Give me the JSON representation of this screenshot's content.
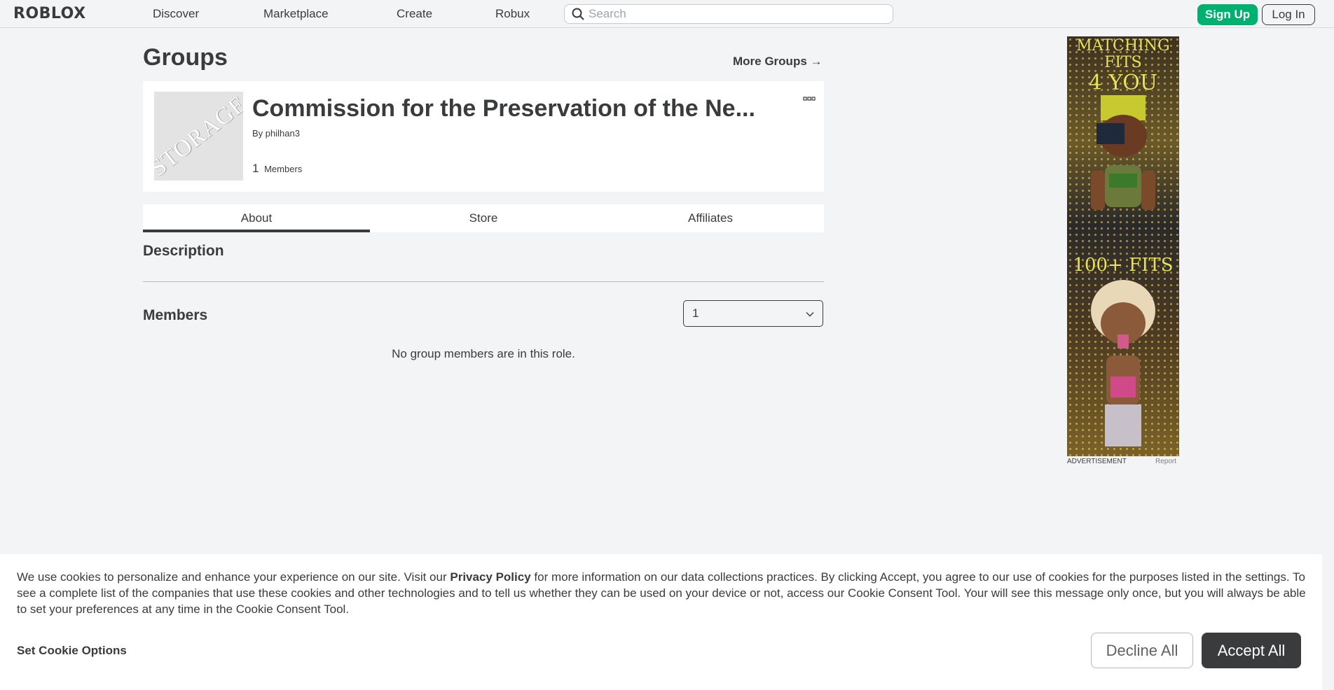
{
  "header": {
    "logo": "ROBLOX",
    "nav": [
      "Discover",
      "Marketplace",
      "Create",
      "Robux"
    ],
    "search_placeholder": "Search",
    "signup_label": "Sign Up",
    "login_label": "Log In"
  },
  "page": {
    "title": "Groups",
    "more_groups": "More Groups →"
  },
  "group": {
    "name": "Commission for the Preservation of the Ne...",
    "thumb_text": "STORAGE",
    "by_prefix": "By",
    "owner": "philhan3",
    "member_count": "1",
    "members_label": "Members"
  },
  "tabs": [
    "About",
    "Store",
    "Affiliates"
  ],
  "active_tab": "About",
  "description": {
    "title": "Description"
  },
  "members": {
    "title": "Members",
    "selected_role": "1",
    "empty_message": "No group members are in this role."
  },
  "ad": {
    "headline_1": "MATCHING",
    "headline_2": "FITS",
    "headline_3": "4 YOU",
    "headline_4": "100+ FITS",
    "label": "ADVERTISEMENT",
    "report": "Report"
  },
  "cookie": {
    "text_before": "We use cookies to personalize and enhance your experience on our site. Visit our ",
    "privacy_link": "Privacy Policy",
    "text_after": " for more information on our data collections practices. By clicking Accept, you agree to our use of cookies for the purposes listed in the settings. To see a complete list of the companies that use these cookies and other technologies and to tell us whether they can be used on your device or not, access our Cookie Consent Tool. Your will see this message only once, but you will always be able to set your preferences at any time in the Cookie Consent Tool.",
    "options_label": "Set Cookie Options",
    "decline_label": "Decline All",
    "accept_label": "Accept All"
  },
  "colors": {
    "signup_green": "#00b06f",
    "text_dark": "#393b3d",
    "background": "#f2f4f5"
  }
}
